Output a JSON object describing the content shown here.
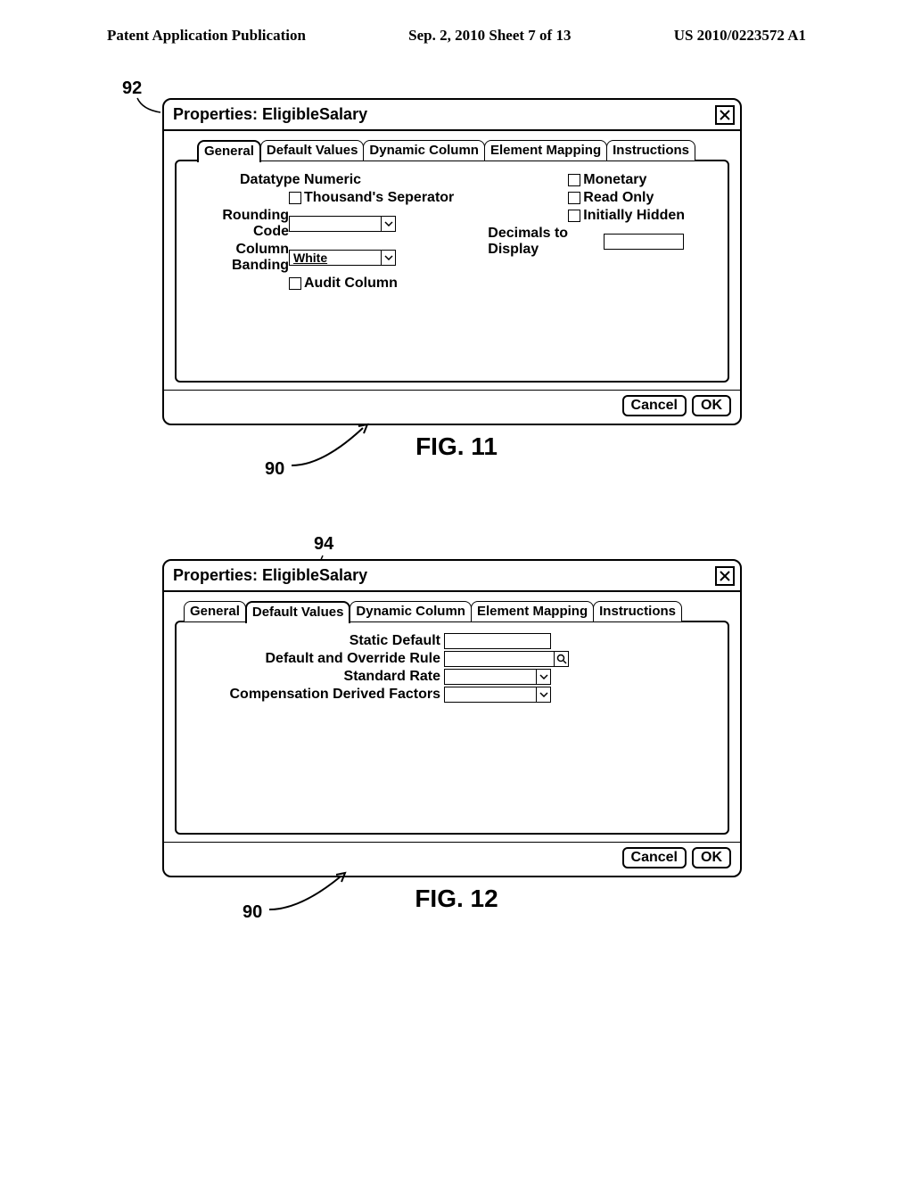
{
  "header": {
    "left": "Patent Application Publication",
    "center": "Sep. 2, 2010  Sheet 7 of 13",
    "right": "US 2010/0223572 A1"
  },
  "fig11": {
    "ref_top": "92",
    "ref_bottom": "90",
    "title": "Properties: EligibleSalary",
    "tabs": [
      "General",
      "Default Values",
      "Dynamic Column",
      "Element Mapping",
      "Instructions"
    ],
    "labels": {
      "datatype": "Datatype Numeric",
      "thousands": "Thousand's Seperator",
      "rounding": "Rounding Code",
      "banding": "Column Banding",
      "banding_val": "White",
      "audit": "Audit Column",
      "monetary": "Monetary",
      "readonly": "Read Only",
      "hidden": "Initially Hidden",
      "decimals": "Decimals to Display"
    },
    "buttons": {
      "cancel": "Cancel",
      "ok": "OK"
    },
    "caption": "FIG. 11"
  },
  "fig12": {
    "ref_top": "94",
    "ref_bottom": "90",
    "title": "Properties: EligibleSalary",
    "tabs": [
      "General",
      "Default Values",
      "Dynamic Column",
      "Element Mapping",
      "Instructions"
    ],
    "labels": {
      "static_default": "Static Default",
      "override_rule": "Default and Override Rule",
      "standard_rate": "Standard Rate",
      "derived_factors": "Compensation Derived Factors"
    },
    "buttons": {
      "cancel": "Cancel",
      "ok": "OK"
    },
    "caption": "FIG. 12"
  }
}
